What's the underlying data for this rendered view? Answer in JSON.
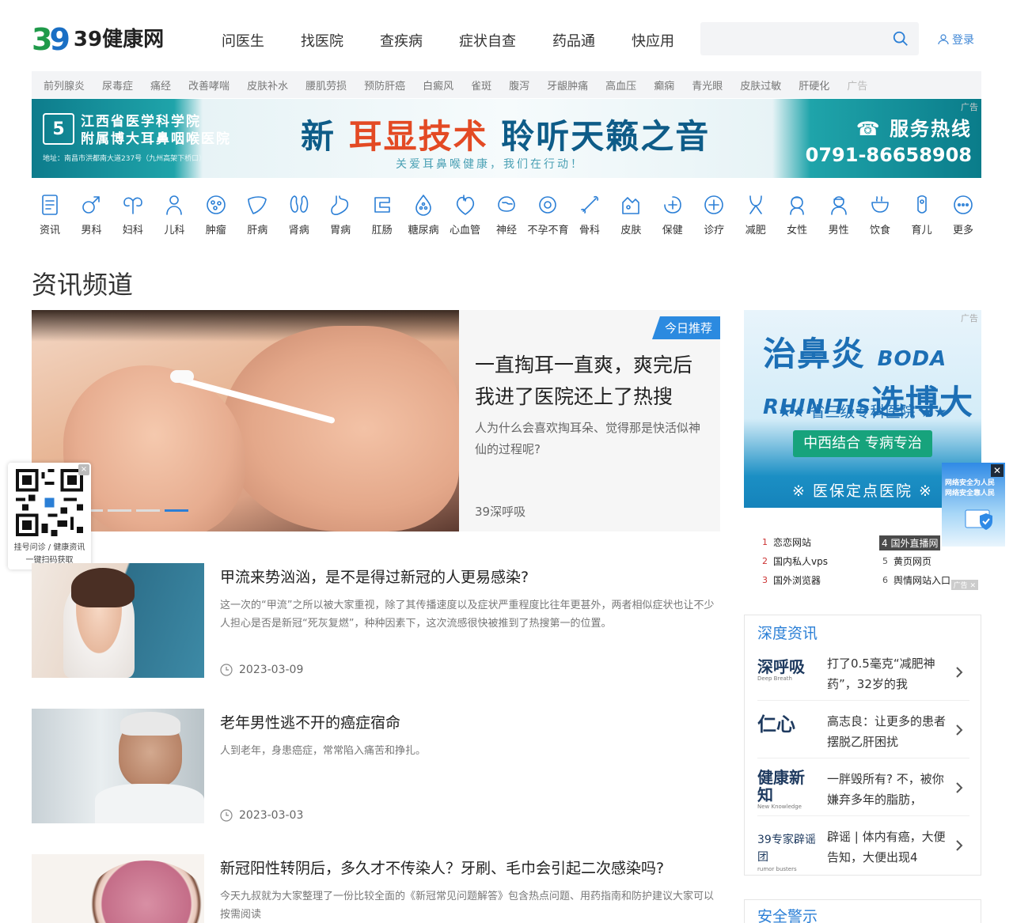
{
  "header": {
    "logo_mark_3": "3",
    "logo_mark_9": "9",
    "logo_text": "39健康网",
    "nav": [
      "问医生",
      "找医院",
      "查疾病",
      "症状自查",
      "药品通",
      "快应用"
    ],
    "search_placeholder": "",
    "login_label": "登录"
  },
  "tags": [
    "前列腺炎",
    "尿毒症",
    "痛经",
    "改善哮喘",
    "皮肤补水",
    "腰肌劳损",
    "预防肝癌",
    "白癜风",
    "雀斑",
    "腹泻",
    "牙龈肿痛",
    "高血压",
    "癫痫",
    "青光眼",
    "皮肤过敏",
    "肝硬化"
  ],
  "tags_ad": "广告",
  "banner": {
    "logo": "5",
    "hospital_line1": "江西省医学科学院",
    "hospital_line2": "附属博大耳鼻咽喉医院",
    "address": "地址：南昌市洪都南大道237号（九州高架下桥口）",
    "slogan_pre": "新",
    "slogan_hl": "耳显技术",
    "slogan_post": "聆听天籁之音",
    "sub": "关爱耳鼻喉健康，我们在行动！",
    "hotline_label": "☎ 服务热线",
    "hotline_number": "0791-86658908",
    "ad": "广告"
  },
  "categories": [
    "资讯",
    "男科",
    "妇科",
    "儿科",
    "肿瘤",
    "肝病",
    "肾病",
    "胃病",
    "肛肠",
    "糖尿病",
    "心血管",
    "神经",
    "不孕不育",
    "骨科",
    "皮肤",
    "保健",
    "诊疗",
    "减肥",
    "女性",
    "男性",
    "饮食",
    "育儿",
    "更多"
  ],
  "section_title": "资讯频道",
  "feature": {
    "badge": "今日推荐",
    "title": "一直掏耳一直爽，爽完后我进了医院还上了热搜",
    "desc": "人为什么会喜欢掏耳朵、觉得那是快活似神仙的过程呢?",
    "source": "39深呼吸",
    "slide_index": 4,
    "slide_count": 4
  },
  "qr": {
    "caption_line1": "挂号问诊 / 健康资讯",
    "caption_line2": "一键扫码获取",
    "close": "×"
  },
  "articles": [
    {
      "title": "甲流来势汹汹，是不是得过新冠的人更易感染?",
      "desc": "这一次的“甲流”之所以被大家重视，除了其传播速度以及症状严重程度比往年更甚外，两者相似症状也让不少人担心是否是新冠“死灰复燃”，种种因素下，这次流感很快被推到了热搜第一的位置。",
      "date": "2023-03-09"
    },
    {
      "title": "老年男性逃不开的癌症宿命",
      "desc": "人到老年，身患癌症，常常陷入痛苦和挣扎。",
      "date": "2023-03-03"
    },
    {
      "title": "新冠阳性转阴后，多久才不传染人？牙刷、毛巾会引起二次感染吗?",
      "desc": "今天九叔就为大家整理了一份比较全面的《新冠常见问题解答》包含热点问题、用药指南和防护建议大家可以按需阅读",
      "date": ""
    }
  ],
  "side_ad": {
    "title_cn": "治鼻炎",
    "title_en1": "BODA",
    "title_en2": "RHINITIS",
    "title_cn2": "选博大",
    "sub": "★★ 省三级专科医院 ★★",
    "pill": "中西结合  专病专治",
    "bottom": "※ 医保定点医院 ※",
    "ad": "广告"
  },
  "security_float": {
    "line1": "网络安全为人民",
    "line2": "网络安全靠人民",
    "close": "✕"
  },
  "rank": [
    {
      "n": "1",
      "t": "恋恋网站"
    },
    {
      "n": "2",
      "t": "国内私人vps"
    },
    {
      "n": "3",
      "t": "国外浏览器"
    },
    {
      "n": "4",
      "t": "国外直播网"
    },
    {
      "n": "5",
      "t": "黄页网页"
    },
    {
      "n": "6",
      "t": "舆情网站入口"
    }
  ],
  "rank_ad": "广告 ✕",
  "deep": {
    "heading": "深度资讯",
    "items": [
      {
        "brand": "深呼吸",
        "brand_sub": "Deep Breath",
        "text": "打了0.5毫克“减肥神药”，32岁的我"
      },
      {
        "brand": "仁心",
        "brand_sub": "",
        "text": "高志良：让更多的患者摆脱乙肝困扰"
      },
      {
        "brand": "健康新知",
        "brand_sub": "New Knowledge",
        "text": "一胖毁所有? 不，被你嫌弃多年的脂肪，"
      },
      {
        "brand": "39专家辟谣团",
        "brand_sub": "rumor busters",
        "text": "辟谣 | 体内有癌，大便告知，大便出现4"
      }
    ]
  },
  "alert_heading": "安全警示",
  "colors": {
    "accent": "#2b7fd6",
    "logo_green": "#1f9a4a",
    "logo_blue": "#1a6fc4",
    "icon_stroke": "#2b7fd6"
  }
}
